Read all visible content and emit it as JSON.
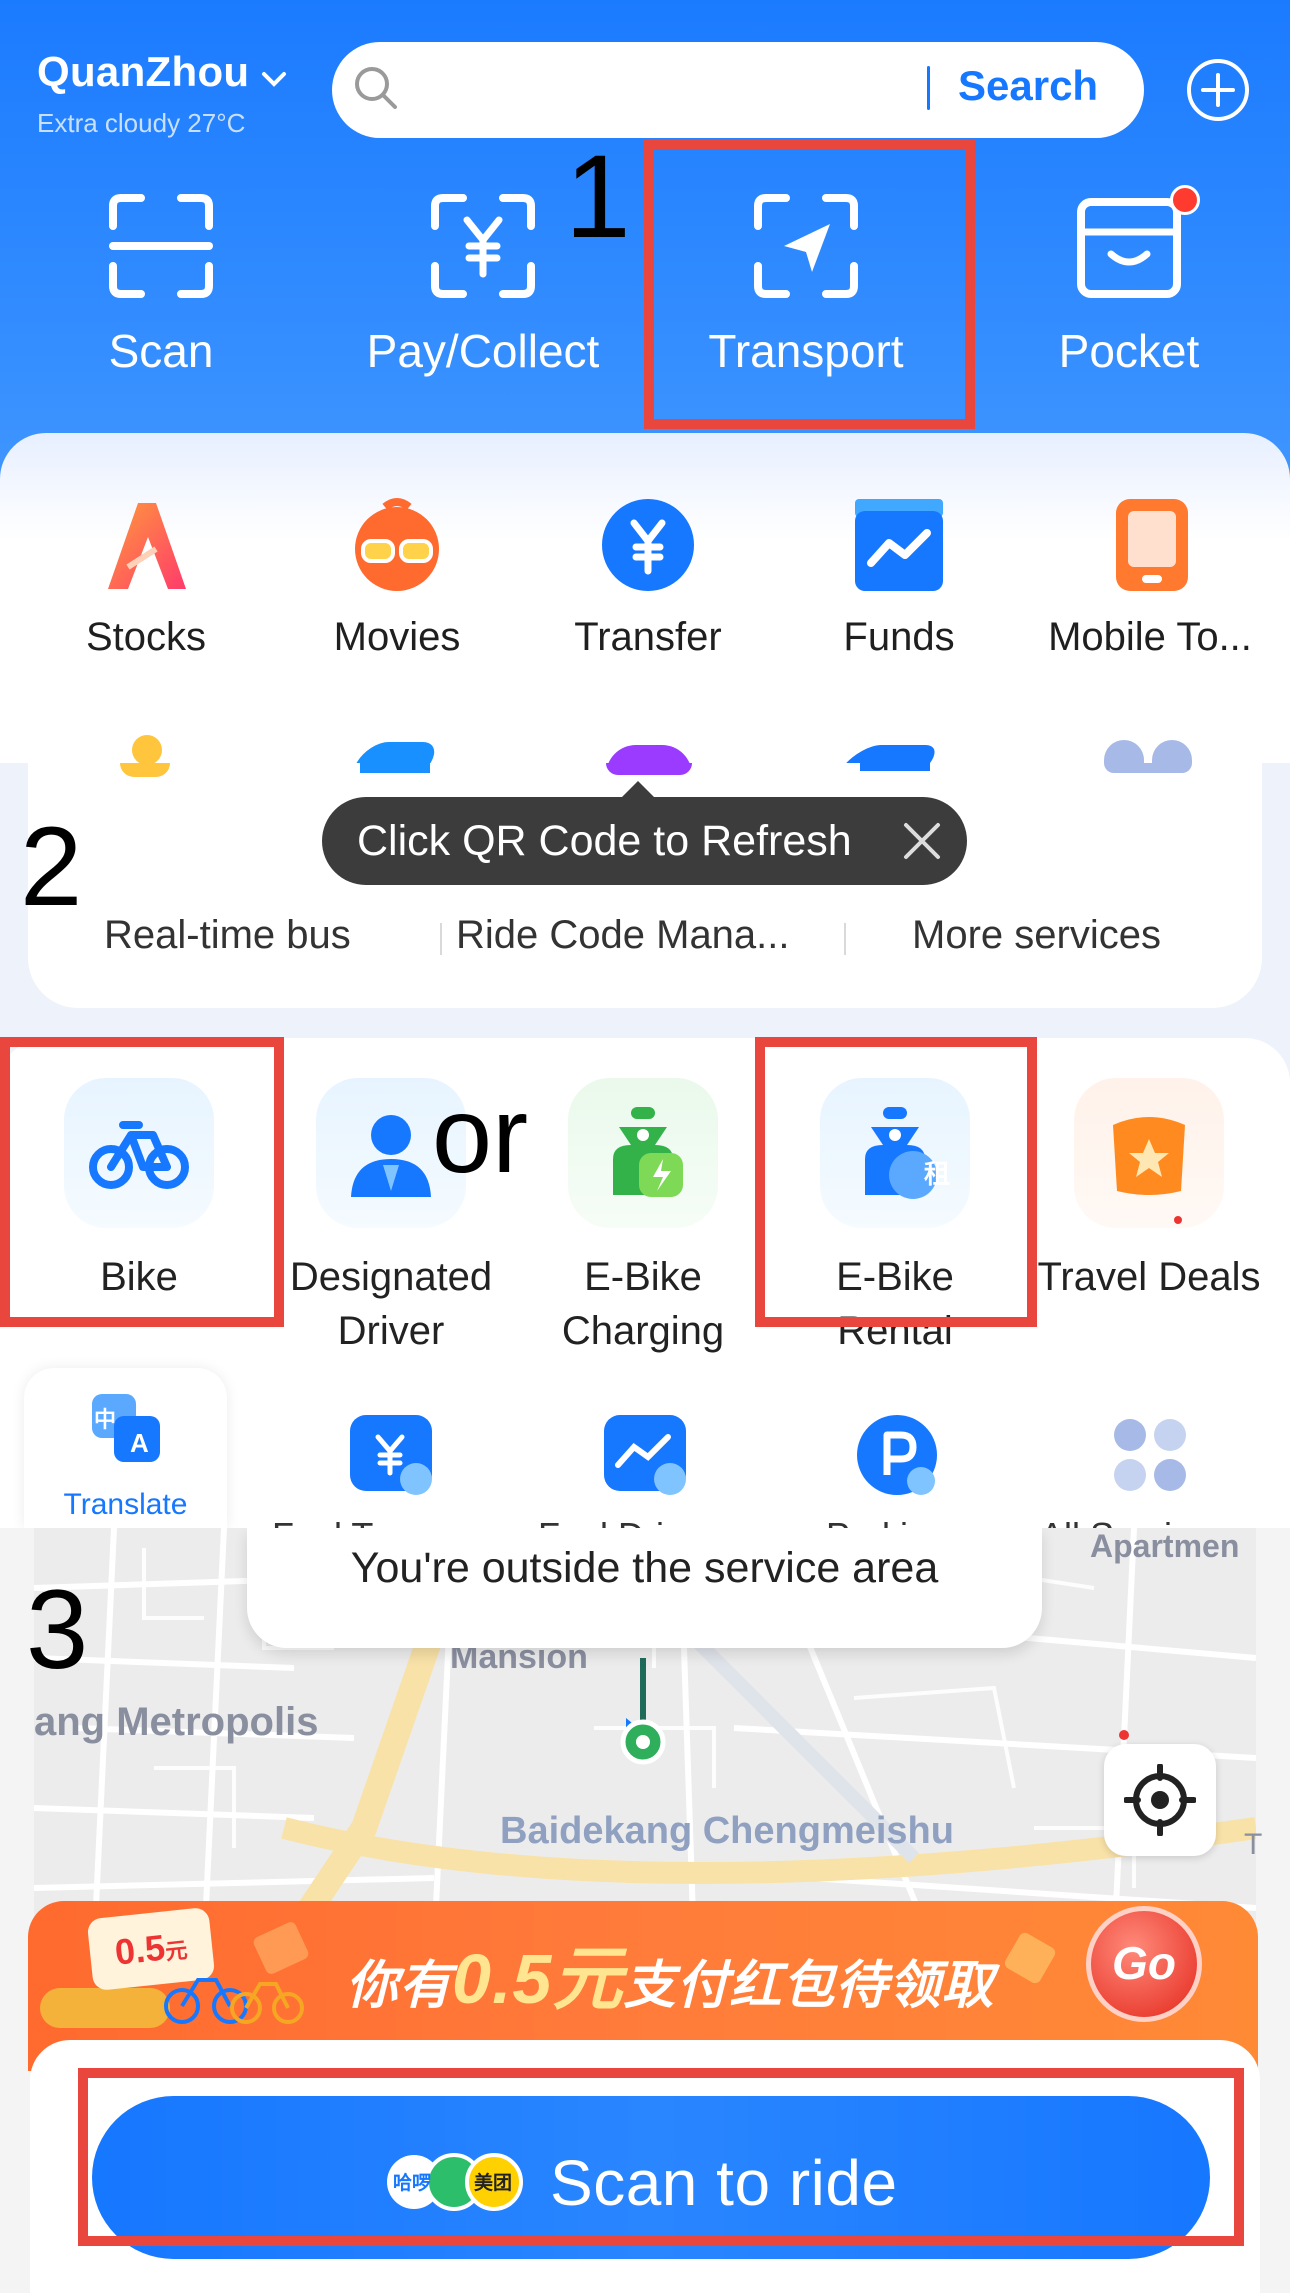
{
  "panel1": {
    "step": "1",
    "city": "QuanZhou",
    "weather": "Extra cloudy 27°C",
    "search_label": "Search",
    "top_actions": [
      "Scan",
      "Pay/Collect",
      "Transport",
      "Pocket"
    ],
    "services": [
      "Stocks",
      "Movies",
      "Transfer",
      "Funds",
      "Mobile To..."
    ]
  },
  "panel2": {
    "step": "2",
    "tooltip": "Click QR Code to Refresh",
    "quick_links": [
      "Real-time bus",
      "Ride Code Mana...",
      "More services"
    ],
    "or_label": "or",
    "tiles": {
      "bike": "Bike",
      "driver_line1": "Designated",
      "driver_line2": "Driver",
      "charging_line1": "E-Bike",
      "charging_line2": "Charging",
      "rental_line1": "E-Bike",
      "rental_line2": "Rental",
      "deals": "Travel Deals",
      "rental_badge": "租"
    },
    "translate_label": "Translate",
    "translate_glyph_top": "中",
    "translate_glyph_bottom": "A",
    "cut_labels": [
      "Fuel T...",
      "Fuel Dri...",
      "Parki...",
      "All Servi..."
    ]
  },
  "panel3": {
    "step": "3",
    "notice": "You're outside the service area",
    "map_labels": {
      "mansion": "Mansion",
      "metropolis": "ang Metropolis",
      "baidekang": "Baidekang Chengmeishu",
      "apartment": "Apartmen",
      "edge_t": "T"
    },
    "coupon_amount": "0.5",
    "coupon_unit": "元",
    "banner_prefix": "你有",
    "banner_amount": "0.5元",
    "banner_suffix": "支付红包待领取",
    "go_label": "Go",
    "logo_text_1": "哈啰",
    "logo_text_2": "美团",
    "ride_button": "Scan to ride"
  },
  "colors": {
    "primary": "#1677ff",
    "highlight": "#e9473e",
    "banner": "#ff7a3a"
  }
}
